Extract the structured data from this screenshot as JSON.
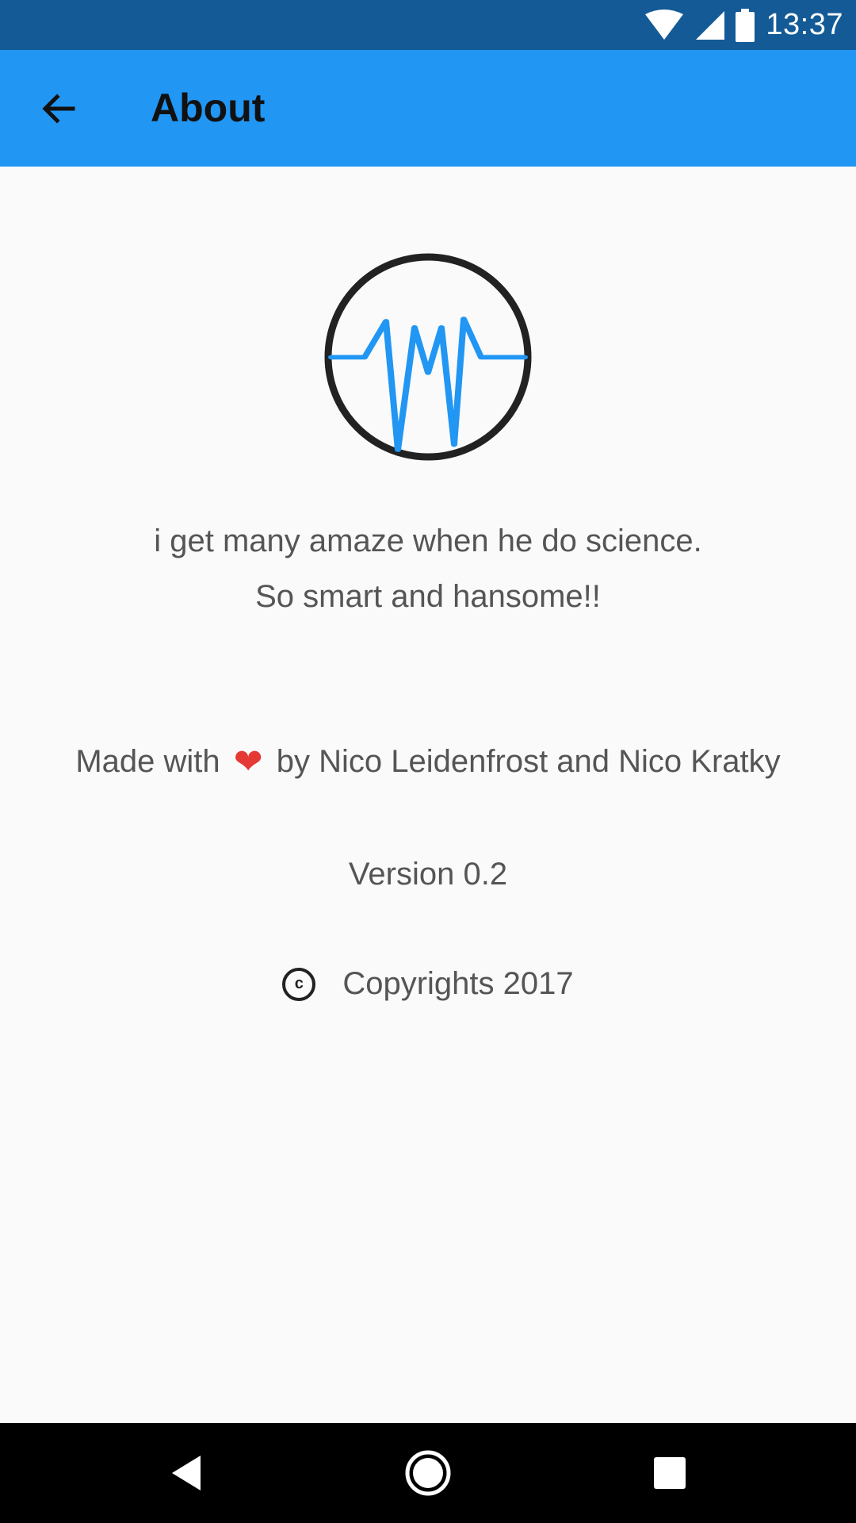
{
  "status_bar": {
    "time": "13:37",
    "icons": [
      "wifi-icon",
      "cell-signal-icon",
      "battery-icon"
    ],
    "background": "#135a96"
  },
  "app_bar": {
    "title": "About",
    "back_icon": "arrow-back-icon",
    "background": "#2196f3"
  },
  "about": {
    "logo_icon": "waveform-logo-icon",
    "logo_accent": "#2196f3",
    "tagline_line1": "i get many amaze when he do science.",
    "tagline_line2": "So smart and hansome!!",
    "credits_prefix": "Made with",
    "credits_heart": "❤",
    "credits_suffix": "by Nico Leidenfrost and Nico Kratky",
    "version": "Version 0.2",
    "copyright_symbol": "c",
    "copyright": "Copyrights 2017"
  },
  "nav_bar": {
    "back_icon": "nav-back-icon",
    "home_icon": "nav-home-icon",
    "recents_icon": "nav-recents-icon"
  }
}
